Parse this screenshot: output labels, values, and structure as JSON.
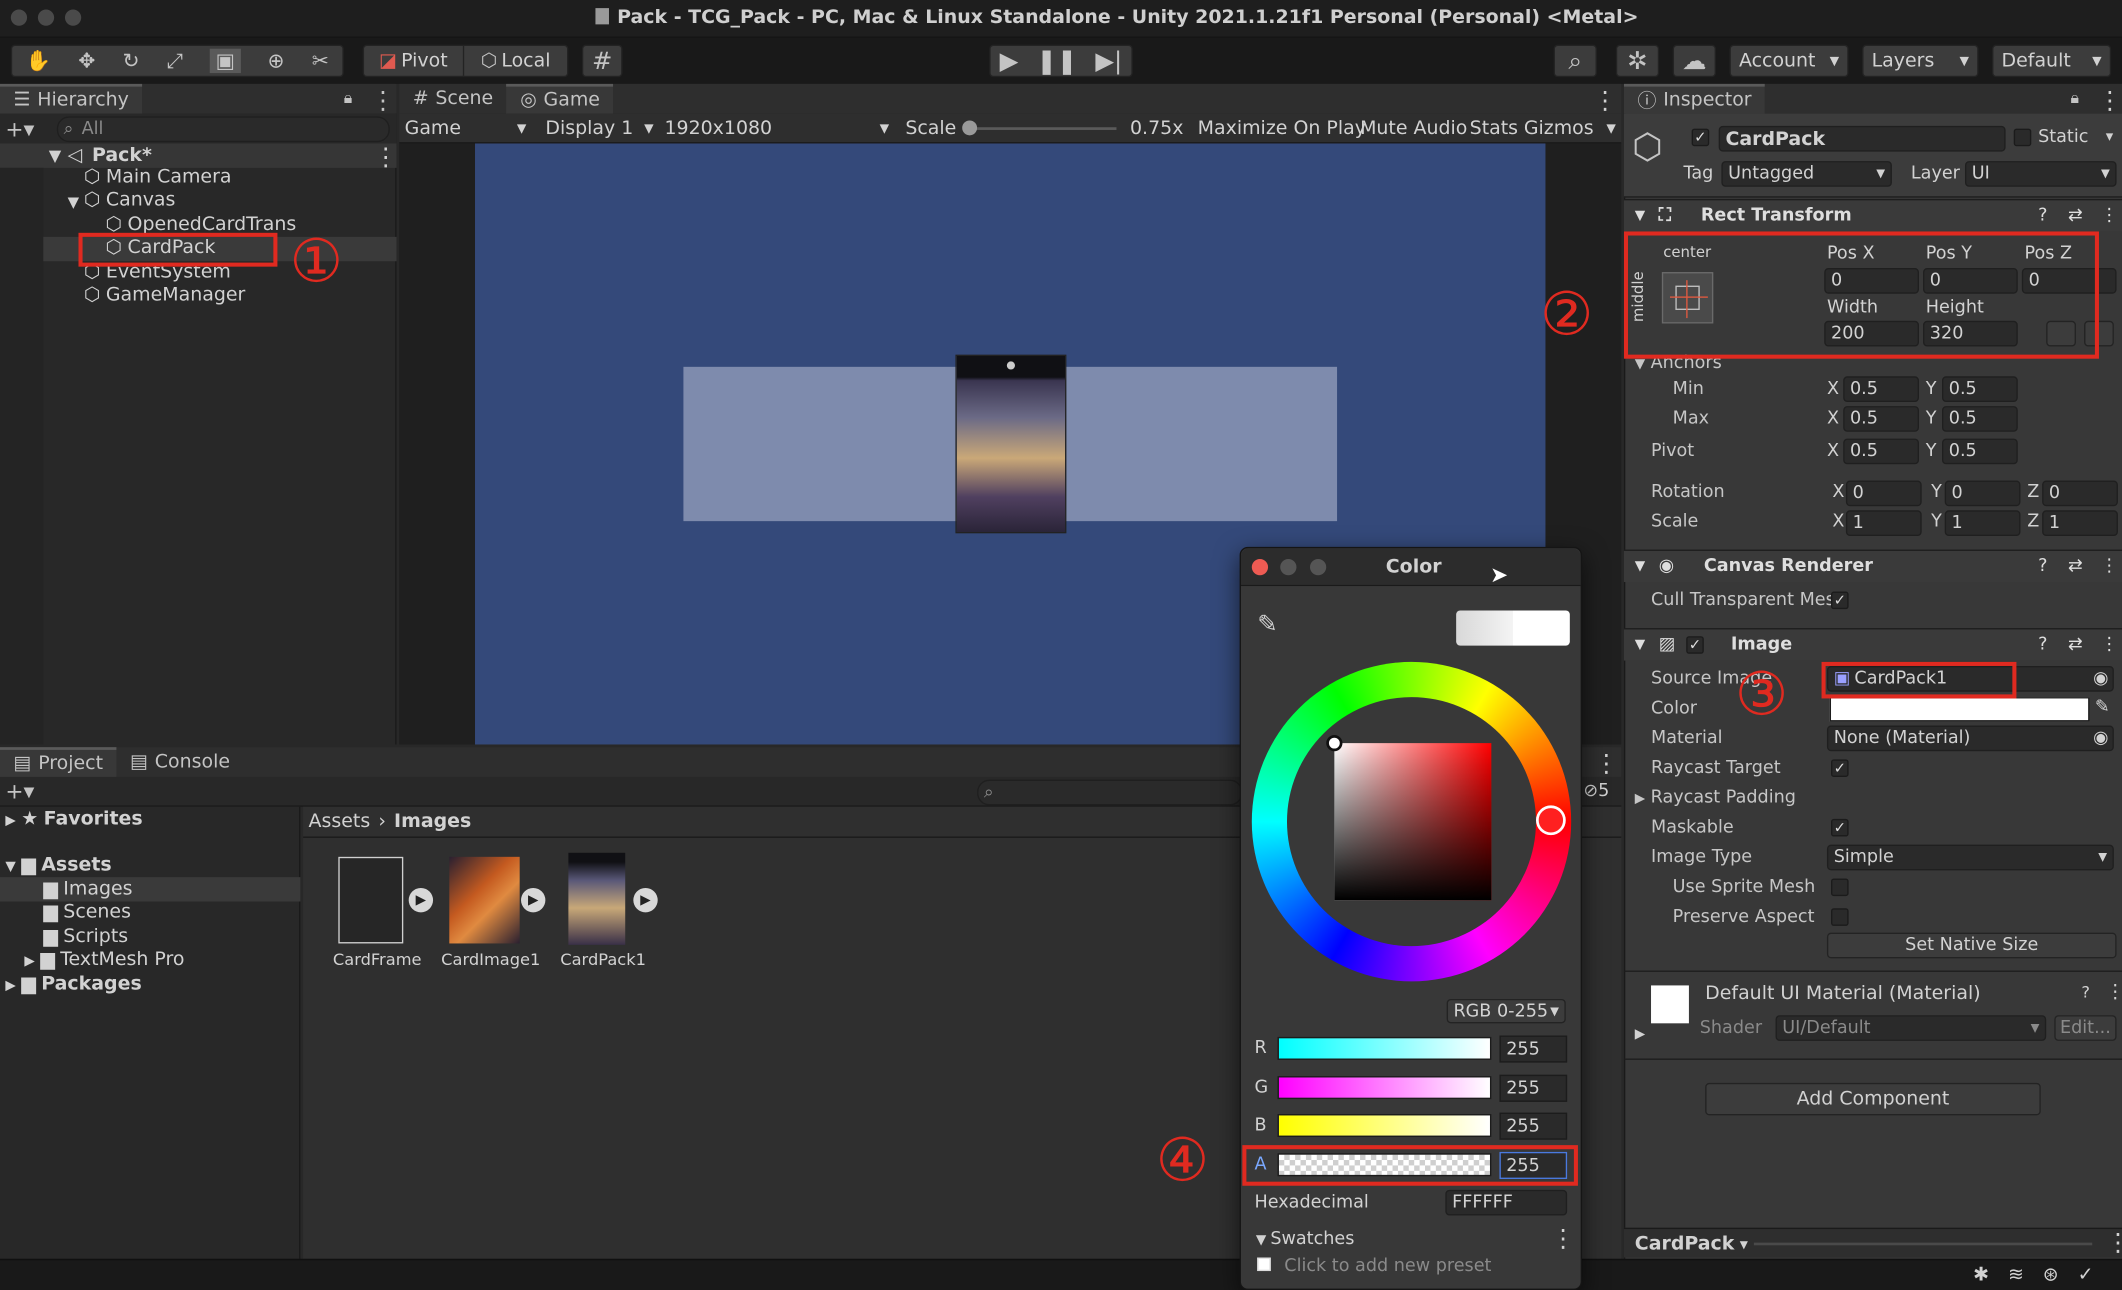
{
  "window": {
    "title": "Pack - TCG_Pack - PC, Mac & Linux Standalone - Unity 2021.1.21f1 Personal (Personal) <Metal>"
  },
  "toolbar": {
    "pivot_label": "Pivot",
    "local_label": "Local",
    "account_label": "Account",
    "layers_label": "Layers",
    "layout_label": "Default"
  },
  "hierarchy": {
    "tab_label": "Hierarchy",
    "search_placeholder": "All",
    "scene": "Pack*",
    "items": [
      "Main Camera",
      "Canvas",
      "OpenedCardTrans",
      "CardPack",
      "EventSystem",
      "GameManager"
    ]
  },
  "game": {
    "scene_tab": "Scene",
    "game_tab": "Game",
    "view_dropdown": "Game",
    "display_dropdown": "Display 1",
    "resolution_dropdown": "1920x1080",
    "scale_label": "Scale",
    "scale_value": "0.75x",
    "maximize_label": "Maximize On Play",
    "mute_label": "Mute Audio",
    "stats_label": "Stats",
    "gizmos_label": "Gizmos",
    "canvas_color": "#34497a",
    "panel_color": "#7e8bad"
  },
  "project": {
    "project_tab": "Project",
    "console_tab": "Console",
    "favorites": "Favorites",
    "assets": "Assets",
    "folders": [
      "Images",
      "Scenes",
      "Scripts",
      "TextMesh Pro"
    ],
    "packages": "Packages",
    "breadcrumb_root": "Assets",
    "breadcrumb_current": "Images",
    "files": [
      "CardFrame",
      "CardImage1",
      "CardPack1"
    ],
    "count": "5"
  },
  "color_picker": {
    "title": "Color",
    "mode": "RGB 0-255",
    "channels": [
      {
        "label": "R",
        "value": "255"
      },
      {
        "label": "G",
        "value": "255"
      },
      {
        "label": "B",
        "value": "255"
      },
      {
        "label": "A",
        "value": "255"
      }
    ],
    "hex_label": "Hexadecimal",
    "hex_value": "FFFFFF",
    "swatches_label": "Swatches",
    "preset_hint": "Click to add new preset"
  },
  "inspector": {
    "tab_label": "Inspector",
    "object_name": "CardPack",
    "static_label": "Static",
    "tag_label": "Tag",
    "tag_value": "Untagged",
    "layer_label": "Layer",
    "layer_value": "UI",
    "rect_transform": {
      "title": "Rect Transform",
      "anchor_h": "center",
      "anchor_v": "middle",
      "pos_x_label": "Pos X",
      "pos_y_label": "Pos Y",
      "pos_z_label": "Pos Z",
      "pos_x": "0",
      "pos_y": "0",
      "pos_z": "0",
      "width_label": "Width",
      "height_label": "Height",
      "width": "200",
      "height": "320",
      "anchors_label": "Anchors",
      "min_label": "Min",
      "max_label": "Max",
      "pivot_label": "Pivot",
      "min_x": "0.5",
      "min_y": "0.5",
      "max_x": "0.5",
      "max_y": "0.5",
      "pivot_x": "0.5",
      "pivot_y": "0.5",
      "rotation_label": "Rotation",
      "scale_label": "Scale",
      "rot_x": "0",
      "rot_y": "0",
      "rot_z": "0",
      "scale_x": "1",
      "scale_y": "1",
      "scale_z": "1"
    },
    "canvas_renderer": {
      "title": "Canvas Renderer",
      "cull_label": "Cull Transparent Mes"
    },
    "image": {
      "title": "Image",
      "source_label": "Source Image",
      "source_value": "CardPack1",
      "color_label": "Color",
      "material_label": "Material",
      "material_value": "None (Material)",
      "raycast_target_label": "Raycast Target",
      "raycast_padding_label": "Raycast Padding",
      "maskable_label": "Maskable",
      "image_type_label": "Image Type",
      "image_type_value": "Simple",
      "sprite_mesh_label": "Use Sprite Mesh",
      "preserve_label": "Preserve Aspect",
      "native_size_label": "Set Native Size"
    },
    "material": {
      "title": "Default UI Material (Material)",
      "shader_label": "Shader",
      "shader_value": "UI/Default",
      "edit_label": "Edit..."
    },
    "add_component_label": "Add Component",
    "footer_label": "CardPack"
  },
  "annotations": [
    "①",
    "②",
    "③",
    "④"
  ]
}
